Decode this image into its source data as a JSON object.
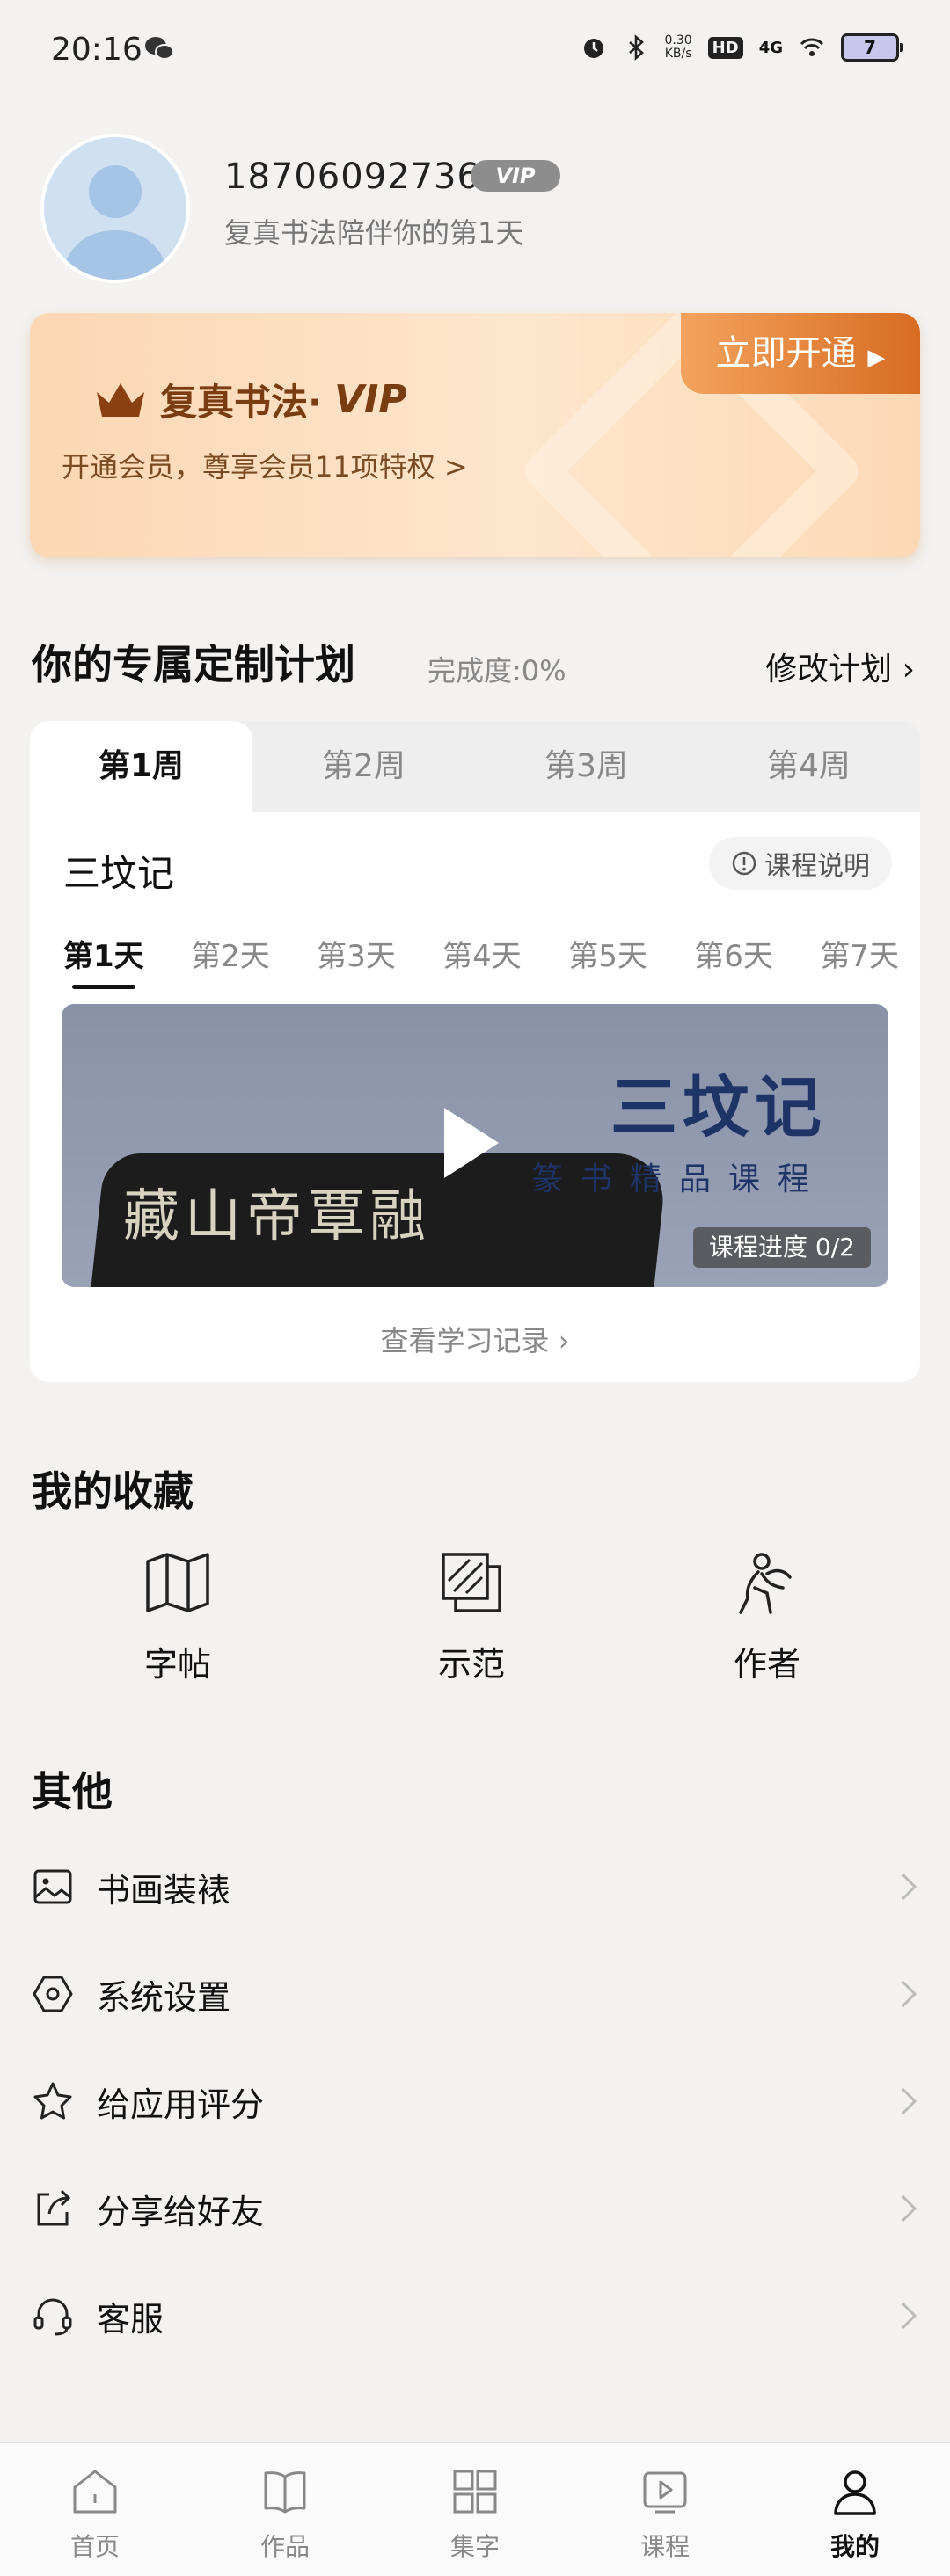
{
  "status_bar": {
    "time": "20:16",
    "net_speed": "0.30",
    "net_unit": "KB/s",
    "hd": "HD",
    "signal": "4G",
    "battery": "7"
  },
  "profile": {
    "phone": "18706092736",
    "vip_badge": "VIP",
    "subtitle": "复真书法陪伴你的第1天"
  },
  "vip_card": {
    "brand": "复真书法·",
    "vip": "VIP",
    "desc": "开通会员，尊享会员11项特权 >",
    "button": "立即开通"
  },
  "plan": {
    "title": "你的专属定制计划",
    "progress": "完成度:0%",
    "edit": "修改计划",
    "weeks": [
      "第1周",
      "第2周",
      "第3周",
      "第4周"
    ],
    "course_name": "三坟记",
    "course_info": "课程说明",
    "days": [
      "第1天",
      "第2天",
      "第3天",
      "第4天",
      "第5天",
      "第6天",
      "第7天"
    ],
    "video_title": "三坟记",
    "video_subtitle": "篆书精品课程",
    "video_glyphs": "藏山帝覃融",
    "video_progress": "课程进度 0/2",
    "record_link": "查看学习记录"
  },
  "favorites": {
    "title": "我的收藏",
    "items": [
      {
        "label": "字帖",
        "icon": "map-icon"
      },
      {
        "label": "示范",
        "icon": "layers-icon"
      },
      {
        "label": "作者",
        "icon": "person-run-icon"
      }
    ]
  },
  "others": {
    "title": "其他",
    "items": [
      {
        "label": "书画装裱",
        "icon": "image-icon"
      },
      {
        "label": "系统设置",
        "icon": "hexagon-settings-icon"
      },
      {
        "label": "给应用评分",
        "icon": "star-icon"
      },
      {
        "label": "分享给好友",
        "icon": "share-icon"
      },
      {
        "label": "客服",
        "icon": "headset-icon"
      }
    ]
  },
  "nav": {
    "items": [
      {
        "label": "首页",
        "icon": "home-icon"
      },
      {
        "label": "作品",
        "icon": "book-icon"
      },
      {
        "label": "集字",
        "icon": "grid-icon"
      },
      {
        "label": "课程",
        "icon": "play-box-icon"
      },
      {
        "label": "我的",
        "icon": "user-icon"
      }
    ]
  }
}
